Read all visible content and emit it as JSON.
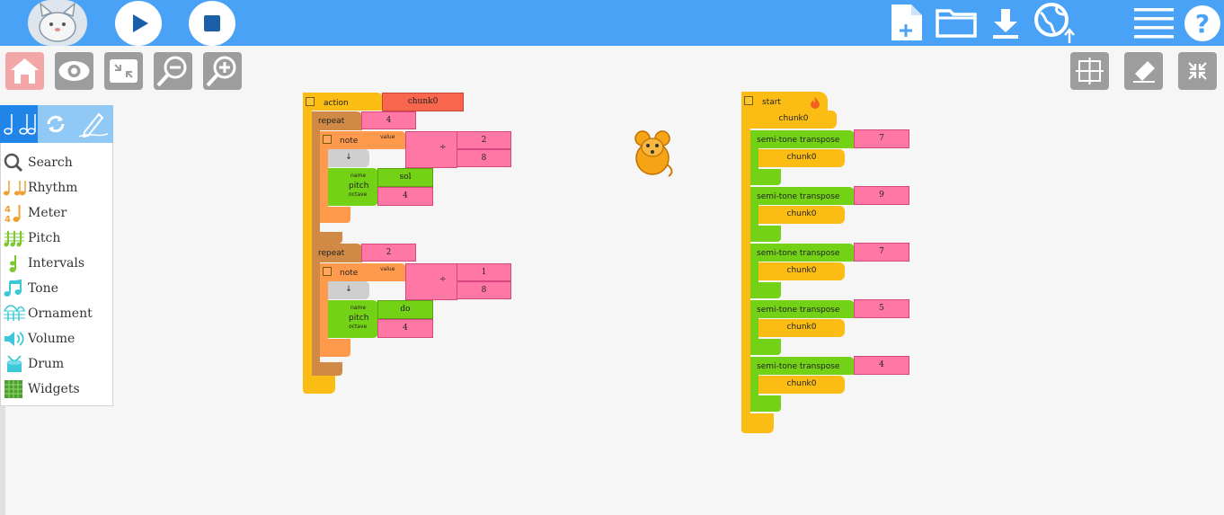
{
  "toolbar": {
    "play_label": "",
    "stop_label": ""
  },
  "palette": {
    "items": [
      {
        "label": "Search",
        "icon": "search-icon",
        "color": "#555555"
      },
      {
        "label": "Rhythm",
        "icon": "rhythm-icon",
        "color": "#f0a030"
      },
      {
        "label": "Meter",
        "icon": "meter-icon",
        "color": "#f0a030"
      },
      {
        "label": "Pitch",
        "icon": "pitch-icon",
        "color": "#7cc832"
      },
      {
        "label": "Intervals",
        "icon": "intervals-icon",
        "color": "#7cc832"
      },
      {
        "label": "Tone",
        "icon": "tone-icon",
        "color": "#3cc8d8"
      },
      {
        "label": "Ornament",
        "icon": "ornament-icon",
        "color": "#3cc8d8"
      },
      {
        "label": "Volume",
        "icon": "volume-icon",
        "color": "#3cc8d8"
      },
      {
        "label": "Drum",
        "icon": "drum-icon",
        "color": "#3cc8d8"
      },
      {
        "label": "Widgets",
        "icon": "widgets-icon",
        "color": "#4aa032"
      }
    ]
  },
  "action_stack": {
    "action_label": "action",
    "action_name": "chunk0",
    "repeats": [
      {
        "label": "repeat",
        "count": "4",
        "note_label": "note",
        "value_label": "value",
        "num": "2",
        "den": "8",
        "div_sign": "÷",
        "arrow": "↓",
        "pitch_label": "pitch",
        "name_label": "name",
        "octave_label": "octave",
        "pitch_name": "sol",
        "octave": "4"
      },
      {
        "label": "repeat",
        "count": "2",
        "note_label": "note",
        "value_label": "value",
        "num": "1",
        "den": "8",
        "div_sign": "÷",
        "arrow": "↓",
        "pitch_label": "pitch",
        "name_label": "name",
        "octave_label": "octave",
        "pitch_name": "do",
        "octave": "4"
      }
    ]
  },
  "start_stack": {
    "start_label": "start",
    "first_chunk": "chunk0",
    "transposes": [
      {
        "label": "semi-tone transpose",
        "value": "7",
        "chunk": "chunk0"
      },
      {
        "label": "semi-tone transpose",
        "value": "9",
        "chunk": "chunk0"
      },
      {
        "label": "semi-tone transpose",
        "value": "7",
        "chunk": "chunk0"
      },
      {
        "label": "semi-tone transpose",
        "value": "5",
        "chunk": "chunk0"
      },
      {
        "label": "semi-tone transpose",
        "value": "4",
        "chunk": "chunk0"
      }
    ]
  },
  "colors": {
    "topbar": "#4aa2f7",
    "action_block": "#fbbd14",
    "repeat_block": "#d08a46",
    "note_block": "#ff9a4c",
    "pitch_block": "#74d216",
    "number_block": "#ff77a5"
  }
}
